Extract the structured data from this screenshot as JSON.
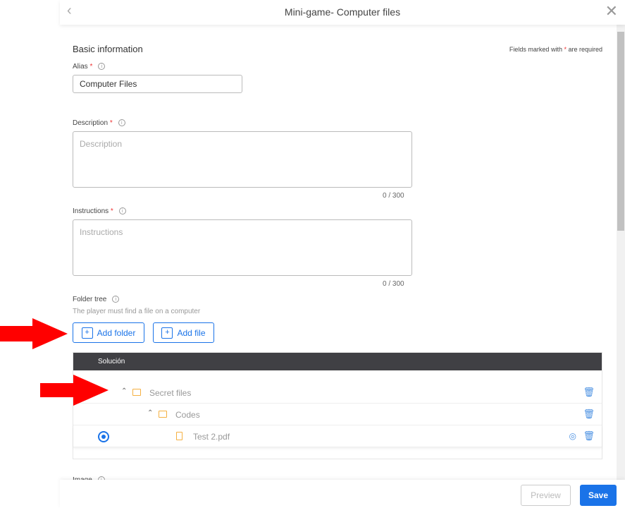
{
  "header": {
    "title": "Mini-game- Computer files"
  },
  "form": {
    "section_title": "Basic information",
    "required_note_prefix": "Fields marked with ",
    "required_star": "*",
    "required_note_suffix": " are required",
    "alias": {
      "label": "Alias",
      "value": "Computer Files"
    },
    "description": {
      "label": "Description",
      "placeholder": "Description",
      "counter": "0 / 300"
    },
    "instructions": {
      "label": "Instructions",
      "placeholder": "Instructions",
      "counter": "0 / 300"
    },
    "folder_tree": {
      "label": "Folder tree",
      "hint": "The player must find a file on a computer",
      "add_folder": "Add folder",
      "add_file": "Add file"
    },
    "image": {
      "label": "Image"
    }
  },
  "tree": {
    "header": "Solución",
    "rows": [
      {
        "name": "Secret files",
        "type": "folder"
      },
      {
        "name": "Codes",
        "type": "folder"
      },
      {
        "name": "Test 2.pdf",
        "type": "file",
        "selected": true
      }
    ]
  },
  "footer": {
    "preview": "Preview",
    "save": "Save"
  },
  "colors": {
    "accent": "#1a73e8",
    "annotation": "#ff0000",
    "folder": "#f5b041"
  }
}
